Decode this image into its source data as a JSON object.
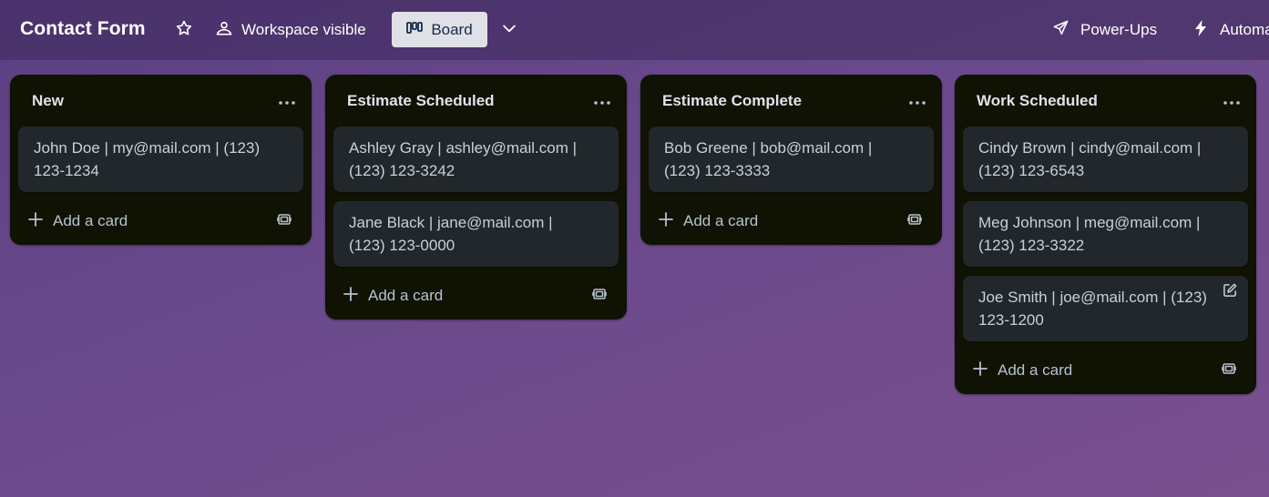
{
  "header": {
    "board_title": "Contact Form",
    "star_icon": "star-icon",
    "visibility_label": "Workspace visible",
    "view_label": "Board",
    "powerups_label": "Power-Ups",
    "automation_label": "Automation"
  },
  "lists": [
    {
      "title": "New",
      "cards": [
        "John Doe | my@mail.com | (123) 123-1234"
      ],
      "add_label": "Add a card"
    },
    {
      "title": "Estimate Scheduled",
      "cards": [
        "Ashley Gray | ashley@mail.com | (123) 123-3242",
        "Jane Black | jane@mail.com | (123) 123-0000"
      ],
      "add_label": "Add a card"
    },
    {
      "title": "Estimate Complete",
      "cards": [
        "Bob Greene | bob@mail.com | (123) 123-3333"
      ],
      "add_label": "Add a card"
    },
    {
      "title": "Work Scheduled",
      "cards": [
        "Cindy Brown | cindy@mail.com | (123) 123-6543",
        "Meg Johnson | meg@mail.com | (123) 123-3322",
        "Joe Smith | joe@mail.com | (123) 123-1200"
      ],
      "add_label": "Add a card"
    }
  ],
  "colors": {
    "list_bg": "#101204",
    "card_bg": "#22272b",
    "card_text": "#c7d1db",
    "view_button_bg": "#dfe1e6"
  }
}
